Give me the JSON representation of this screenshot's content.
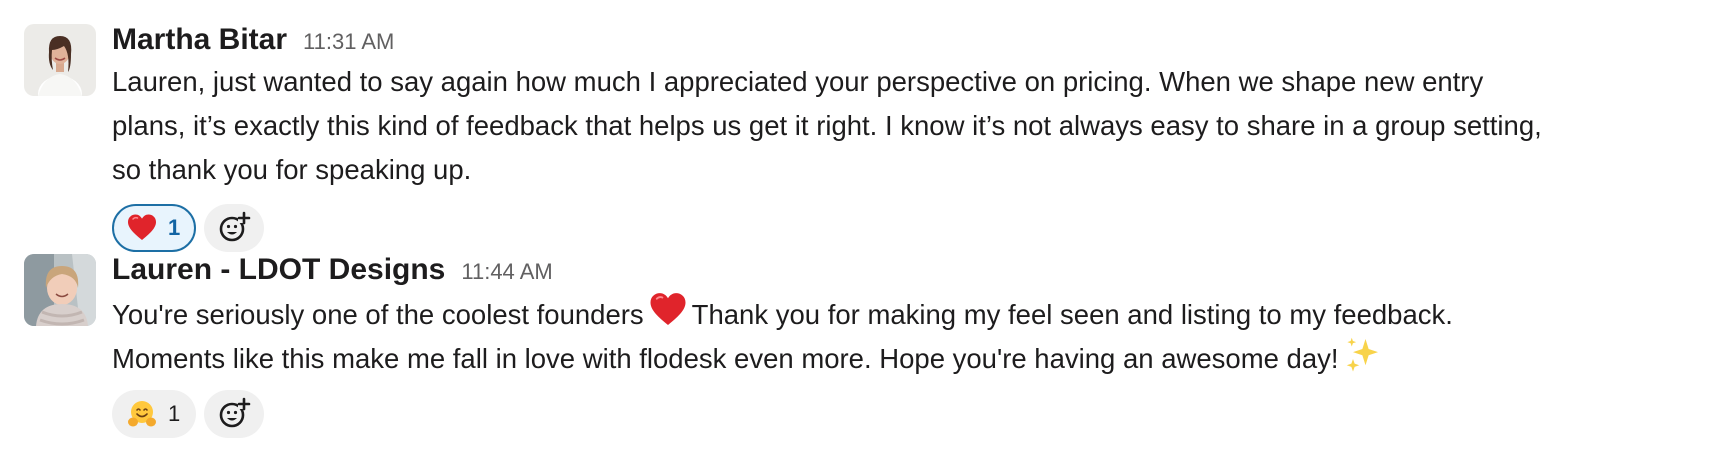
{
  "messages": [
    {
      "sender": "Martha Bitar",
      "timestamp": "11:31 AM",
      "avatar_icon": "avatar-woman-white-shirt",
      "lines": [
        "Lauren, just wanted to say again how much I appreciated your perspective on pricing. When we shape new entry",
        "plans, it’s exactly this kind of feedback that helps us get it right. I know it’s not always easy to share in a group setting,",
        "so thank you for speaking up."
      ],
      "reactions": [
        {
          "emoji": "heart-emoji",
          "count": "1",
          "reacted_by_me": true
        }
      ]
    },
    {
      "sender": "Lauren - LDOT Designs",
      "timestamp": "11:44 AM",
      "avatar_icon": "avatar-woman-scarf",
      "line1_before_emoji": "You're seriously one of the coolest founders",
      "line1_emoji": "heart-emoji",
      "line1_after_emoji": "Thank you for making my feel seen and listing to my feedback.",
      "line2_text": "Moments like this make me fall in love with flodesk even more. Hope you're having an awesome day!",
      "line2_emoji": "sparkles-emoji",
      "reactions": [
        {
          "emoji": "hugging-face-emoji",
          "count": "1",
          "reacted_by_me": false
        }
      ]
    }
  ],
  "add_reaction_icon": "add-reaction-icon",
  "colors": {
    "active_reaction_border": "#1d6fa5",
    "active_reaction_bg": "#e8f4fd",
    "active_count_text": "#1264a3",
    "timestamp": "#616061",
    "text": "#1d1c1d"
  }
}
